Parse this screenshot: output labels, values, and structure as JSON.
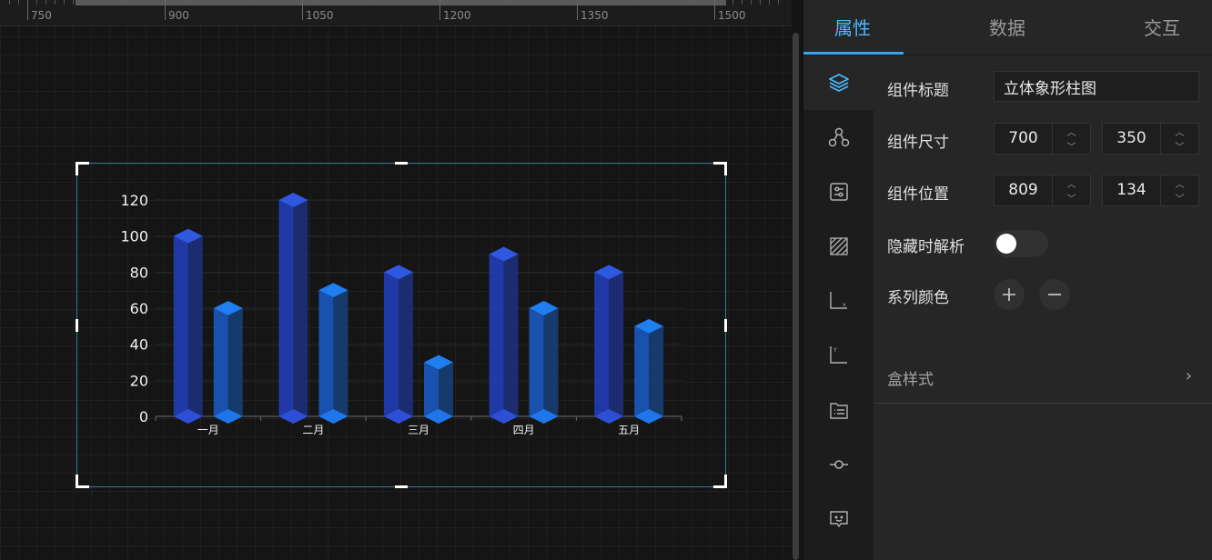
{
  "ruler": {
    "labels": [
      "750",
      "900",
      "1050",
      "1200",
      "1350",
      "1500"
    ]
  },
  "panel": {
    "tabs": [
      {
        "label": "属性",
        "active": true
      },
      {
        "label": "数据",
        "active": false
      },
      {
        "label": "交互",
        "active": false
      }
    ],
    "side_icons": [
      "layers-icon",
      "nodes-icon",
      "settings-panel-icon",
      "hatch-area-icon",
      "x-axis-icon",
      "y-axis-icon",
      "legend-list-icon",
      "series-point-icon",
      "tooltip-icon"
    ],
    "form": {
      "title_label": "组件标题",
      "title_value": "立体象形柱图",
      "size_label": "组件尺寸",
      "width": "700",
      "height": "350",
      "position_label": "组件位置",
      "pos_x": "809",
      "pos_y": "134",
      "hide_parse_label": "隐藏时解析",
      "hide_parse_on": false,
      "series_color_label": "系列颜色",
      "add_label": "+",
      "remove_label": "−",
      "box_style_label": "盒样式",
      "chevron": "›"
    }
  },
  "accent_color": "#3aa3ef",
  "chart_data": {
    "type": "bar",
    "style": "3d-cuboid",
    "categories": [
      "一月",
      "二月",
      "三月",
      "四月",
      "五月"
    ],
    "series": [
      {
        "values": [
          100,
          120,
          80,
          90,
          80
        ],
        "color": "#2446c4"
      },
      {
        "values": [
          60,
          70,
          30,
          60,
          50
        ],
        "color": "#1565d6"
      }
    ],
    "yticks": [
      "0",
      "20",
      "40",
      "60",
      "80",
      "100",
      "120"
    ],
    "ylim": [
      0,
      120
    ],
    "grid": true
  }
}
